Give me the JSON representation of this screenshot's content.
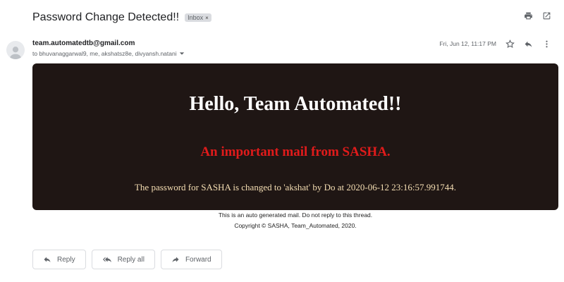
{
  "email": {
    "subject": "Password Change Detected!!",
    "badge": "Inbox",
    "badge_close": "×",
    "sender": "team.automatedtb@gmail.com",
    "recipients": "to bhuvanaggarwal9, me, akshatsz8e, divyansh.natani",
    "date": "Fri, Jun 12, 11:17 PM"
  },
  "content": {
    "greeting": "Hello, Team Automated!!",
    "important_line": "An important mail from SASHA.",
    "message": "The password for SASHA is changed to 'akshat' by Do at 2020-06-12 23:16:57.991744."
  },
  "footer": {
    "auto_note": "This is an auto generated mail. Do not reply to this thread.",
    "copyright": "Copyright © SASHA, Team_Automated, 2020."
  },
  "actions": {
    "reply": "Reply",
    "reply_all": "Reply all",
    "forward": "Forward"
  },
  "icons": {
    "print": "print-icon",
    "open_new": "open-in-new-icon",
    "star": "star-icon",
    "reply": "reply-icon",
    "more": "more-vert-icon",
    "avatar": "person-icon",
    "dropdown": "chevron-down-icon"
  },
  "colors": {
    "card_bg": "#1f1614",
    "greeting": "#ffffff",
    "important": "#e01b1b",
    "message": "#f5deb3"
  }
}
